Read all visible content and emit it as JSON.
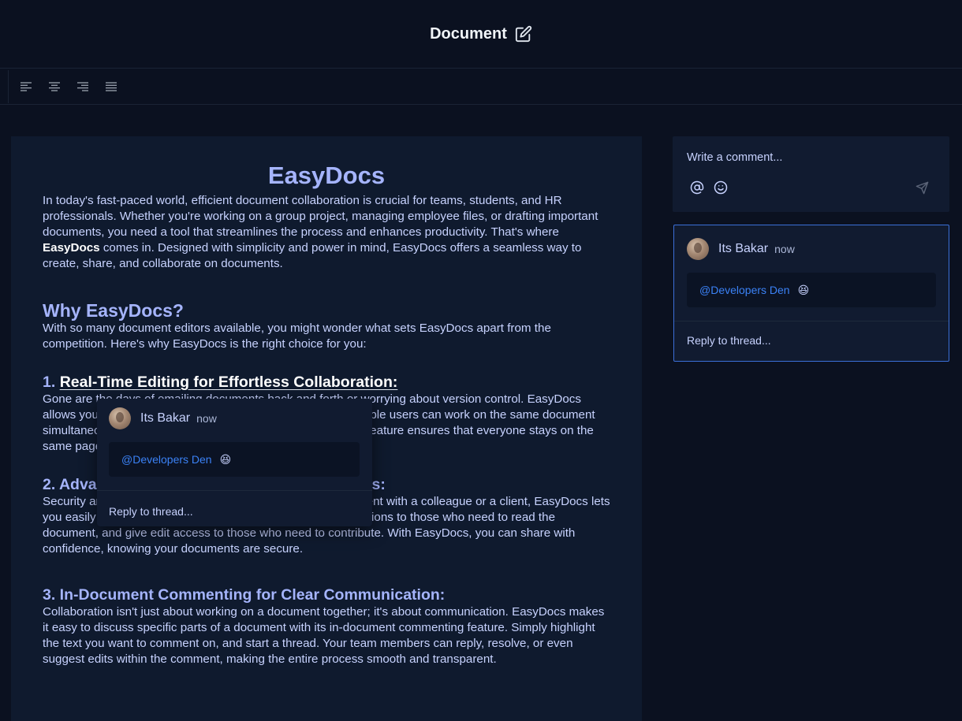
{
  "header": {
    "title": "Document",
    "edit_icon": "edit-icon"
  },
  "toolbar": {
    "buttons": [
      "align-left-icon",
      "align-center-icon",
      "align-right-icon",
      "align-justify-icon"
    ]
  },
  "document": {
    "title": "EasyDocs",
    "intro_before": "In today's fast-paced world, efficient document collaboration is crucial for teams, students, and HR professionals. Whether you're working on a group project, managing employee files, or drafting important documents, you need a tool that streamlines the process and enhances productivity. That's where ",
    "intro_bold": "EasyDocs",
    "intro_after": " comes in. Designed with simplicity and power in mind, EasyDocs offers a seamless way to create, share, and collaborate on documents.",
    "why_heading": "Why EasyDocs?",
    "why_text": "With so many document editors available, you might wonder what sets EasyDocs apart from the competition. Here's why EasyDocs is the right choice for you:",
    "s1_num": "1. ",
    "s1_heading": "Real-Time Editing for Effortless Collaboration:",
    "s1_text": "Gone are the days of emailing documents back and forth or worrying about version control. EasyDocs allows you and your team to edit documents in real time. Multiple users can work on the same document simultaneously, and you'll see changes as they happen. This feature ensures that everyone stays on the same page.",
    "s2_heading": "2. Advanced Sharing and Permission Controls:",
    "s2_text": "Security and privacy matter. Whether you're sharing a document with a colleague or a client, EasyDocs lets you easily manage who has access. Assign view-only permissions to those who need to read the document, and give edit access to those who need to contribute. With EasyDocs, you can share with confidence, knowing your documents are secure.",
    "s3_heading": "3. In-Document Commenting for Clear Communication:",
    "s3_text": "Collaboration isn't just about working on a document together; it's about communication. EasyDocs makes it easy to discuss specific parts of a document with its in-document commenting feature. Simply highlight the text you want to comment on, and start a thread. Your team members can reply, resolve, or even suggest edits within the comment, making the entire process smooth and transparent."
  },
  "popup_thread": {
    "user": "Its Bakar",
    "time": "now",
    "mention": "@Developers Den",
    "emoji": "😆",
    "reply_placeholder": "Reply to thread..."
  },
  "comment_box": {
    "placeholder": "Write a comment...",
    "icons": [
      "at-icon",
      "smiley-icon",
      "send-icon"
    ]
  },
  "sidebar_thread": {
    "user": "Its Bakar",
    "time": "now",
    "mention": "@Developers Den",
    "emoji": "😆",
    "reply_placeholder": "Reply to thread..."
  },
  "colors": {
    "background": "#0b1120",
    "panel": "#0f1a2e",
    "accent": "#3b82f6",
    "heading": "#a5b4fc"
  }
}
